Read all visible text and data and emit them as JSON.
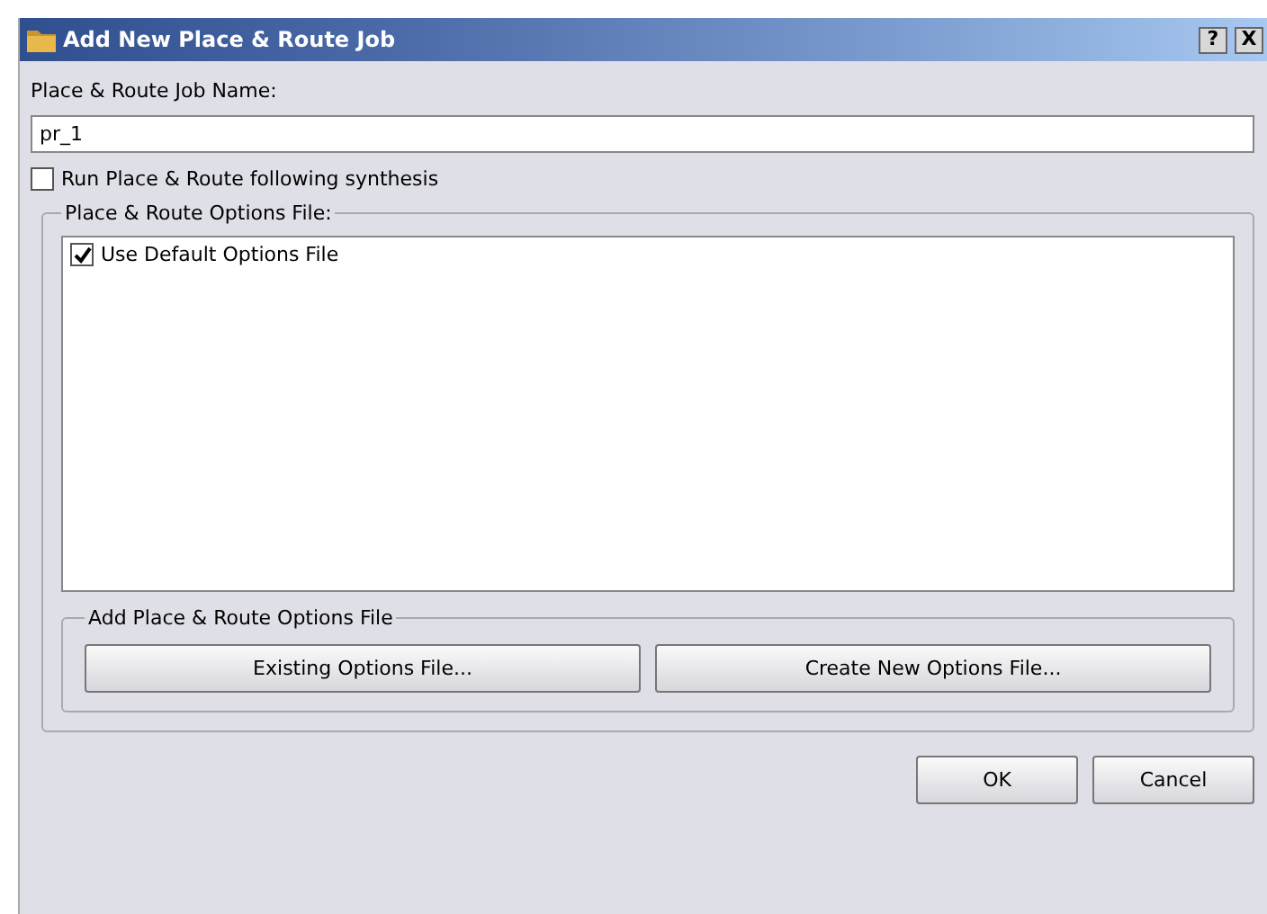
{
  "window": {
    "title": "Add New Place & Route Job",
    "help_button": "?",
    "close_button": "X"
  },
  "job_name": {
    "label": "Place & Route Job Name:",
    "value": "pr_1"
  },
  "run_after_synthesis": {
    "label": "Run Place & Route following synthesis",
    "checked": false
  },
  "options_group": {
    "title": "Place & Route Options File:",
    "items": [
      {
        "label": "Use Default Options File",
        "checked": true
      }
    ]
  },
  "add_group": {
    "title": "Add Place & Route Options File",
    "buttons": [
      "Existing Options File...",
      "Create New Options File..."
    ]
  },
  "buttons": [
    "OK",
    "Cancel"
  ]
}
